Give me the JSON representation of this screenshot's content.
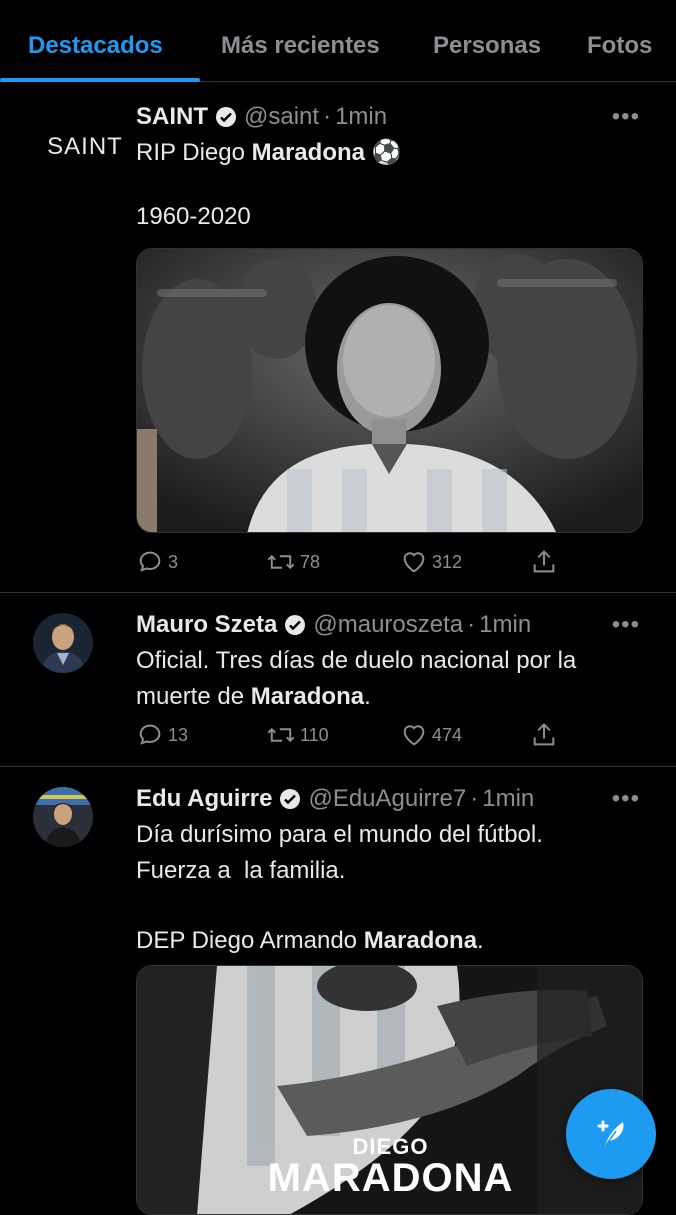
{
  "tabs": [
    {
      "label": "Destacados",
      "active": true
    },
    {
      "label": "Más recientes",
      "active": false
    },
    {
      "label": "Personas",
      "active": false
    },
    {
      "label": "Fotos",
      "active": false
    }
  ],
  "tweets": [
    {
      "name": "SAINT",
      "handle": "@saint",
      "time": "1min",
      "avatar_text": "SAINT",
      "text_line1_pre": "RIP Diego ",
      "text_line1_bold": "Maradona",
      "text_line1_emoji": "⚽",
      "text_line2": "1960-2020",
      "replies": "3",
      "retweets": "78",
      "likes": "312"
    },
    {
      "name": "Mauro Szeta",
      "handle": "@mauroszeta",
      "time": "1min",
      "text_line1": "Oficial. Tres días de duelo nacional por la",
      "text_line2_pre": "muerte de ",
      "text_line2_bold": "Maradona",
      "text_line2_post": ".",
      "replies": "13",
      "retweets": "110",
      "likes": "474"
    },
    {
      "name": "Edu Aguirre",
      "handle": "@EduAguirre7",
      "time": "1min",
      "text_line1": "Día durísimo para el mundo del fútbol.",
      "text_line2": "Fuerza a  la familia.",
      "text_line3_pre": "DEP Diego Armando ",
      "text_line3_bold": "Maradona",
      "text_line3_post": ".",
      "media_caption_small": "DIEGO",
      "media_caption_big": "MARADONA"
    }
  ],
  "separator": "·",
  "more_label": "•••",
  "colors": {
    "accent": "#1d9bf0",
    "muted": "#8b8f94",
    "background": "#000000"
  }
}
